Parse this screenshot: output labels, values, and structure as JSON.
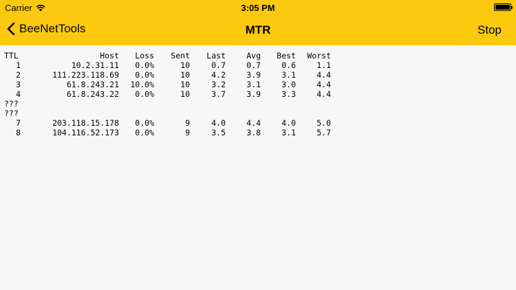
{
  "status_bar": {
    "carrier": "Carrier",
    "time": "3:05 PM",
    "battery_level": 1.0
  },
  "nav": {
    "back_label": "BeeNetTools",
    "title": "MTR",
    "stop_label": "Stop"
  },
  "table": {
    "headers": [
      "TTL",
      "Host",
      "Loss",
      "Sent",
      "Last",
      "Avg",
      "Best",
      "Worst"
    ],
    "rows": [
      [
        "1",
        "10.2.31.11",
        "0.0%",
        "10",
        "0.7",
        "0.7",
        "0.6",
        "1.1"
      ],
      [
        "2",
        "111.223.118.69",
        "0.0%",
        "10",
        "4.2",
        "3.9",
        "3.1",
        "4.4"
      ],
      [
        "3",
        "61.8.243.21",
        "10.0%",
        "10",
        "3.2",
        "3.1",
        "3.0",
        "4.4"
      ],
      [
        "4",
        "61.8.243.22",
        "0.0%",
        "10",
        "3.7",
        "3.9",
        "3.3",
        "4.4"
      ],
      [
        "???"
      ],
      [
        "???"
      ],
      [
        "7",
        "203.118.15.178",
        "0.0%",
        "9",
        "4.0",
        "4.4",
        "4.0",
        "5.0"
      ],
      [
        "8",
        "104.116.52.173",
        "0.0%",
        "9",
        "3.5",
        "3.8",
        "3.1",
        "5.7"
      ]
    ]
  },
  "colors": {
    "nav_bar": "#fdc90f",
    "background": "#f7f7f7",
    "text": "#000000"
  },
  "icons": {
    "back": "chevron-left-icon",
    "wifi": "wifi-icon",
    "battery": "battery-icon"
  }
}
